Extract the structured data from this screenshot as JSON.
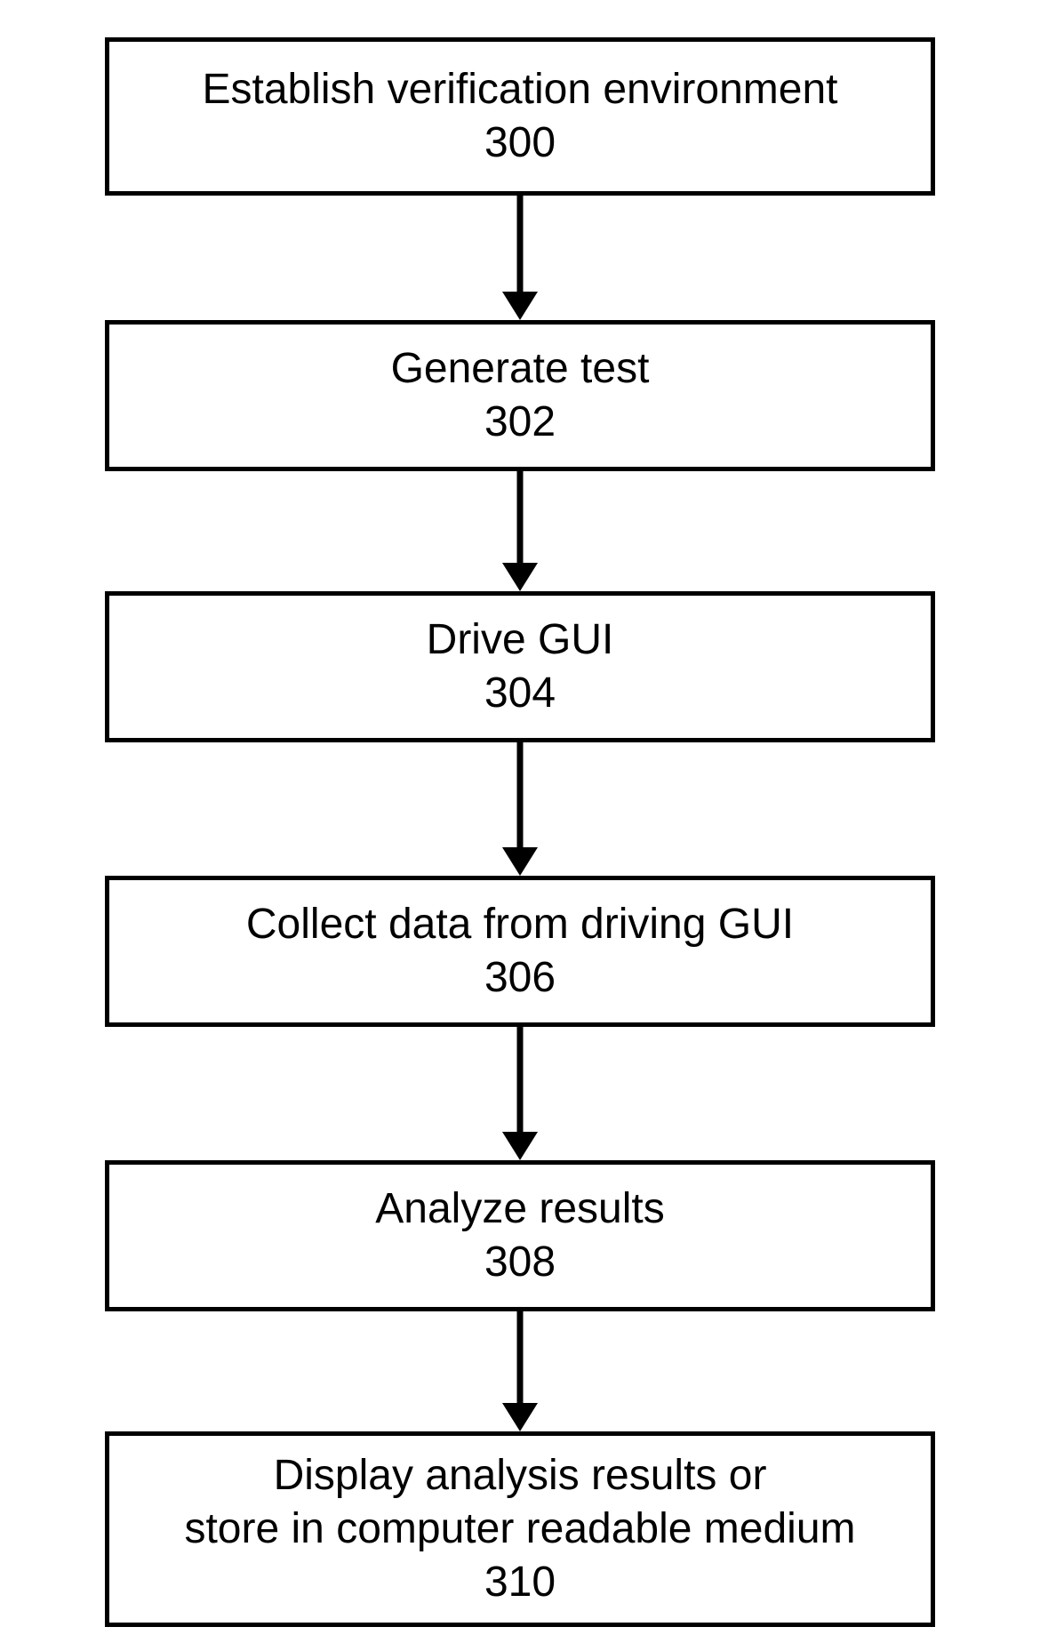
{
  "diagram": {
    "type": "flowchart-vertical",
    "nodes": [
      {
        "label": "Establish verification environment",
        "num": "300"
      },
      {
        "label": "Generate test",
        "num": "302"
      },
      {
        "label": "Drive GUI",
        "num": "304"
      },
      {
        "label": "Collect data from driving GUI",
        "num": "306"
      },
      {
        "label": "Analyze results",
        "num": "308"
      },
      {
        "label": "Display analysis results or\nstore in computer readable medium",
        "num": "310"
      }
    ]
  }
}
